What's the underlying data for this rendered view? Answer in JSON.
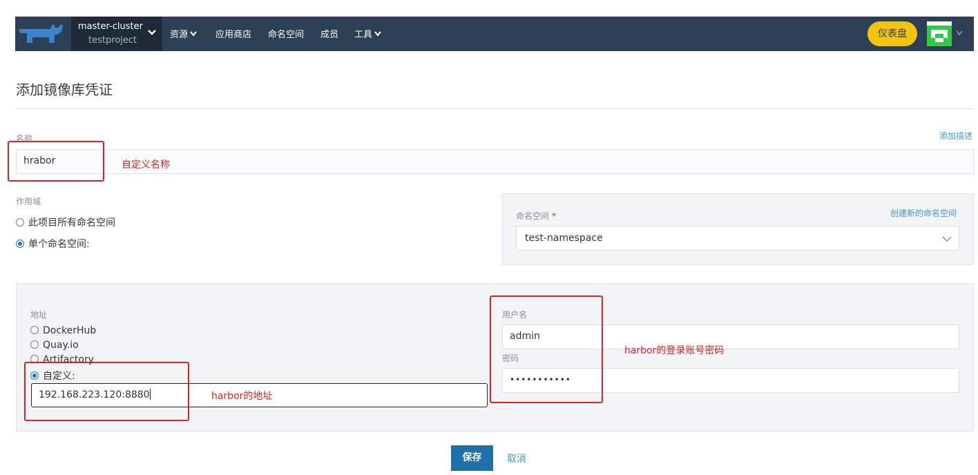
{
  "header": {
    "cluster_name": "master-cluster",
    "project_name": "testproject",
    "menu": [
      {
        "label": "资源",
        "has_dropdown": true
      },
      {
        "label": "应用商店",
        "has_dropdown": false
      },
      {
        "label": "命名空间",
        "has_dropdown": false
      },
      {
        "label": "成员",
        "has_dropdown": false
      },
      {
        "label": "工具",
        "has_dropdown": true
      }
    ],
    "dashboard_label": "仪表盘",
    "accent_color": "#f1c40f",
    "nav_bg_color": "#2d3f54"
  },
  "page": {
    "title": "添加镜像库凭证"
  },
  "name_field": {
    "label": "名称",
    "value": "hrabor",
    "add_description_link": "添加描述"
  },
  "scope": {
    "label": "作用域",
    "options": [
      {
        "label": "此项目所有命名空间",
        "selected": false
      },
      {
        "label": "单个命名空间:",
        "selected": true
      }
    ]
  },
  "namespace": {
    "label": "命名空间",
    "required_mark": "*",
    "create_link": "创建新的命名空间",
    "selected": "test-namespace"
  },
  "registry": {
    "address_label": "地址",
    "options": [
      {
        "label": "DockerHub",
        "selected": false
      },
      {
        "label": "Quay.io",
        "selected": false
      },
      {
        "label": "Artifactory",
        "selected": false
      },
      {
        "label": "自定义:",
        "selected": true
      }
    ],
    "custom_value": "192.168.223.120:8880",
    "username_label": "用户名",
    "username_value": "admin",
    "password_label": "密码",
    "password_value": "•••••••••••"
  },
  "actions": {
    "save_label": "保存",
    "cancel_label": "取消"
  },
  "annotations": {
    "name_note": "自定义名称",
    "address_note": "harbor的地址",
    "account_note": "harbor的登录账号密码",
    "color": "#e02020"
  }
}
